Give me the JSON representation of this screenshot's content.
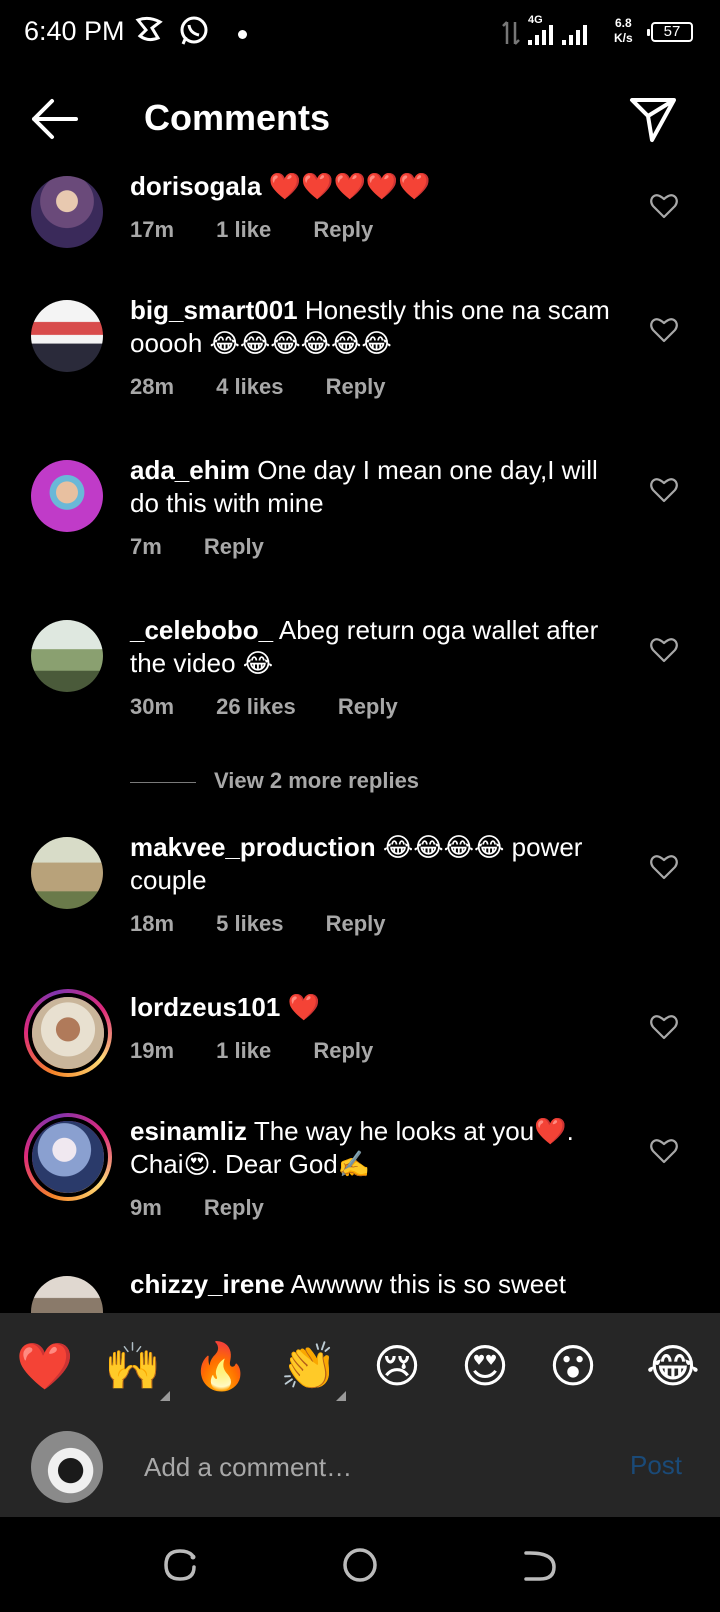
{
  "status_bar": {
    "time": "6:40 PM",
    "network": "4G",
    "net_speed_value": "6.8",
    "net_speed_unit": "K/s",
    "battery": "57"
  },
  "header": {
    "title": "Comments"
  },
  "comments": [
    {
      "username": "dorisogala",
      "text": "❤️❤️❤️❤️❤️",
      "time": "17m",
      "likes": "1 like",
      "reply": "Reply",
      "avatar_color": "#7b5a8a"
    },
    {
      "username": "big_smart001",
      "text": "Honestly this one na scam ooooh 😂😂😂😂😂😂",
      "time": "28m",
      "likes": "4 likes",
      "reply": "Reply",
      "avatar_color": "#d84b4b"
    },
    {
      "username": "ada_ehim",
      "text": "One day I mean one day,I will do this with mine",
      "time": "7m",
      "likes": "",
      "reply": "Reply",
      "avatar_color": "#c03bc8"
    },
    {
      "username": "_celebobo_",
      "text": "Abeg return oga wallet after the video 😂",
      "time": "30m",
      "likes": "26 likes",
      "reply": "Reply",
      "avatar_color": "#8a9b78"
    },
    {
      "username": "makvee_production",
      "text": "😂😂😂😂 power couple",
      "time": "18m",
      "likes": "5 likes",
      "reply": "Reply",
      "avatar_color": "#b8a27a"
    },
    {
      "username": "lordzeus101",
      "text": "❤️",
      "time": "19m",
      "likes": "1 like",
      "reply": "Reply",
      "avatar_color": "#c9b59a"
    },
    {
      "username": "esinamliz",
      "text": "The way he looks at you❤️. Chai😍. Dear God✍️",
      "time": "9m",
      "likes": "",
      "reply": "Reply",
      "avatar_color": "#5a6fa0"
    },
    {
      "username": "chizzy_irene",
      "text": "Awwww this is so sweet",
      "avatar_color": "#8a7a6a"
    }
  ],
  "view_more_replies": "View 2 more replies",
  "reactions": [
    "❤️",
    "🙌",
    "🔥",
    "👏",
    "😢",
    "😍",
    "😮",
    "😂"
  ],
  "composer": {
    "placeholder": "Add a comment…",
    "post_label": "Post",
    "avatar_color": "#6a6a6a"
  },
  "colors": {
    "background": "#000000",
    "secondary_text": "#a8a8a8",
    "panel": "#262626",
    "post_disabled": "#1a4a78"
  }
}
